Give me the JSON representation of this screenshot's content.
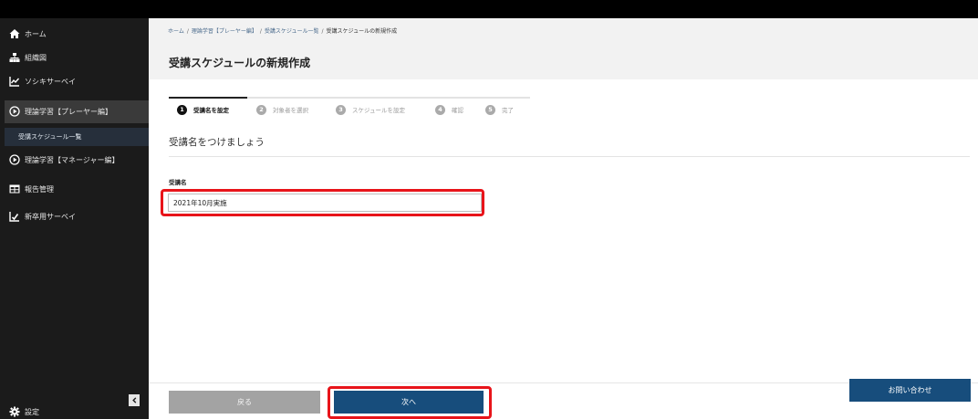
{
  "sidebar": {
    "items": [
      {
        "label": "ホーム",
        "icon": "home-icon"
      },
      {
        "label": "組織図",
        "icon": "org-chart-icon"
      },
      {
        "label": "ソシキサーベイ",
        "icon": "line-chart-icon"
      },
      {
        "label": "理論学習【プレーヤー編】",
        "icon": "play-circle-icon",
        "active": true
      },
      {
        "label": "受講スケジュール一覧",
        "sub": true
      },
      {
        "label": "理論学習【マネージャー編】",
        "icon": "play-circle-icon"
      },
      {
        "label": "報告管理",
        "icon": "table-icon"
      },
      {
        "label": "新卒用サーベイ",
        "icon": "survey-chart-icon"
      }
    ],
    "settings_label": "設定"
  },
  "header": {
    "breadcrumb": [
      "ホーム",
      "理論学習【プレーヤー編】",
      "受講スケジュール一覧",
      "受講スケジュールの新規作成"
    ],
    "title": "受講スケジュールの新規作成"
  },
  "steps": [
    {
      "num": "1",
      "label": "受講名を設定",
      "current": true
    },
    {
      "num": "2",
      "label": "対象者を選択"
    },
    {
      "num": "3",
      "label": "スケジュールを設定"
    },
    {
      "num": "4",
      "label": "確認"
    },
    {
      "num": "5",
      "label": "完了"
    }
  ],
  "form": {
    "section_title": "受講名をつけましょう",
    "field_label": "受講名",
    "field_value": "2021年10月実施"
  },
  "buttons": {
    "back": "戻る",
    "next": "次へ",
    "contact": "お問い合わせ"
  },
  "colors": {
    "primary": "#174d7c",
    "highlight": "#e8141a",
    "sidebar_bg": "#1b1b1b"
  }
}
